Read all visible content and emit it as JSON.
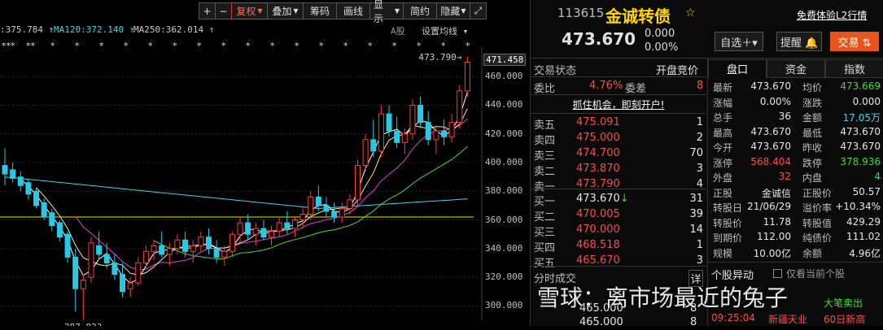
{
  "toolbar": {
    "plus": "+",
    "minus": "−",
    "fuquan": "复权",
    "diejia": "叠加",
    "chouma": "筹码",
    "huaxian": "画线",
    "xianshi": "显示",
    "jianyue": "简约",
    "yincang": "隐藏",
    "expand": "⤢"
  },
  "ma_labels": {
    "ma_a": ":375.784 ↑",
    "ma120": "MA120:372.140 ↑",
    "ma250": "MA250:362.014 ↑",
    "a_share": "A股",
    "settings": "设置均线"
  },
  "chart_data": {
    "type": "candlestick",
    "title": "",
    "ylim": [
      290,
      476
    ],
    "y_ticks": [
      300,
      320,
      340,
      360,
      380,
      400,
      420,
      440,
      460
    ],
    "y_tick_labels": [
      "300.000",
      "320.000",
      "340.000",
      "360.000",
      "380.000",
      "400.000",
      "420.000",
      "440.000",
      "460.000"
    ],
    "current_price_label": "471.458",
    "high_label": "473.790",
    "low_label": "287.823",
    "high_value": 473.79,
    "low_value": 287.823,
    "reference_price": 362,
    "markers": [
      "***",
      "**",
      "*",
      "*",
      "*",
      "*",
      "*",
      "*",
      "*",
      "*",
      "*",
      "*",
      "*",
      "*",
      "*",
      "*",
      "*",
      "*",
      "*",
      "*"
    ],
    "candles": [
      {
        "o": 398,
        "h": 410,
        "l": 384,
        "c": 392
      },
      {
        "o": 395,
        "h": 400,
        "l": 386,
        "c": 389
      },
      {
        "o": 390,
        "h": 394,
        "l": 380,
        "c": 384
      },
      {
        "o": 386,
        "h": 388,
        "l": 374,
        "c": 378
      },
      {
        "o": 380,
        "h": 382,
        "l": 368,
        "c": 370
      },
      {
        "o": 372,
        "h": 375,
        "l": 360,
        "c": 362
      },
      {
        "o": 365,
        "h": 368,
        "l": 352,
        "c": 356
      },
      {
        "o": 358,
        "h": 360,
        "l": 345,
        "c": 348
      },
      {
        "o": 350,
        "h": 352,
        "l": 330,
        "c": 334
      },
      {
        "o": 334,
        "h": 340,
        "l": 296,
        "c": 312
      },
      {
        "o": 312,
        "h": 322,
        "l": 290,
        "c": 318
      },
      {
        "o": 320,
        "h": 348,
        "l": 316,
        "c": 344
      },
      {
        "o": 342,
        "h": 352,
        "l": 332,
        "c": 336
      },
      {
        "o": 336,
        "h": 344,
        "l": 326,
        "c": 330
      },
      {
        "o": 330,
        "h": 336,
        "l": 318,
        "c": 322
      },
      {
        "o": 322,
        "h": 330,
        "l": 306,
        "c": 310
      },
      {
        "o": 312,
        "h": 320,
        "l": 306,
        "c": 316
      },
      {
        "o": 316,
        "h": 334,
        "l": 314,
        "c": 330
      },
      {
        "o": 330,
        "h": 342,
        "l": 326,
        "c": 338
      },
      {
        "o": 338,
        "h": 346,
        "l": 332,
        "c": 342
      },
      {
        "o": 342,
        "h": 352,
        "l": 334,
        "c": 336
      },
      {
        "o": 336,
        "h": 344,
        "l": 328,
        "c": 340
      },
      {
        "o": 340,
        "h": 350,
        "l": 336,
        "c": 346
      },
      {
        "o": 346,
        "h": 352,
        "l": 334,
        "c": 338
      },
      {
        "o": 338,
        "h": 346,
        "l": 330,
        "c": 342
      },
      {
        "o": 342,
        "h": 352,
        "l": 338,
        "c": 348
      },
      {
        "o": 348,
        "h": 354,
        "l": 336,
        "c": 340
      },
      {
        "o": 340,
        "h": 346,
        "l": 330,
        "c": 334
      },
      {
        "o": 334,
        "h": 342,
        "l": 328,
        "c": 338
      },
      {
        "o": 338,
        "h": 352,
        "l": 334,
        "c": 350
      },
      {
        "o": 350,
        "h": 362,
        "l": 344,
        "c": 358
      },
      {
        "o": 358,
        "h": 364,
        "l": 346,
        "c": 350
      },
      {
        "o": 350,
        "h": 358,
        "l": 342,
        "c": 354
      },
      {
        "o": 354,
        "h": 360,
        "l": 346,
        "c": 348
      },
      {
        "o": 348,
        "h": 356,
        "l": 342,
        "c": 352
      },
      {
        "o": 352,
        "h": 362,
        "l": 348,
        "c": 358
      },
      {
        "o": 358,
        "h": 366,
        "l": 350,
        "c": 354
      },
      {
        "o": 354,
        "h": 362,
        "l": 348,
        "c": 360
      },
      {
        "o": 360,
        "h": 368,
        "l": 354,
        "c": 364
      },
      {
        "o": 364,
        "h": 380,
        "l": 360,
        "c": 376
      },
      {
        "o": 376,
        "h": 384,
        "l": 366,
        "c": 370
      },
      {
        "o": 370,
        "h": 376,
        "l": 362,
        "c": 366
      },
      {
        "o": 366,
        "h": 372,
        "l": 358,
        "c": 362
      },
      {
        "o": 362,
        "h": 372,
        "l": 358,
        "c": 368
      },
      {
        "o": 368,
        "h": 378,
        "l": 364,
        "c": 374
      },
      {
        "o": 374,
        "h": 402,
        "l": 370,
        "c": 398
      },
      {
        "o": 398,
        "h": 420,
        "l": 394,
        "c": 416
      },
      {
        "o": 416,
        "h": 430,
        "l": 404,
        "c": 408
      },
      {
        "o": 408,
        "h": 440,
        "l": 404,
        "c": 434
      },
      {
        "o": 434,
        "h": 440,
        "l": 418,
        "c": 422
      },
      {
        "o": 422,
        "h": 432,
        "l": 410,
        "c": 414
      },
      {
        "o": 414,
        "h": 424,
        "l": 406,
        "c": 420
      },
      {
        "o": 420,
        "h": 444,
        "l": 416,
        "c": 440
      },
      {
        "o": 440,
        "h": 446,
        "l": 424,
        "c": 428
      },
      {
        "o": 428,
        "h": 436,
        "l": 412,
        "c": 416
      },
      {
        "o": 416,
        "h": 426,
        "l": 406,
        "c": 422
      },
      {
        "o": 422,
        "h": 430,
        "l": 412,
        "c": 418
      },
      {
        "o": 418,
        "h": 434,
        "l": 414,
        "c": 428
      },
      {
        "o": 428,
        "h": 454,
        "l": 424,
        "c": 450
      },
      {
        "o": 450,
        "h": 474,
        "l": 446,
        "c": 470
      }
    ]
  },
  "header": {
    "code": "113615",
    "name": "金诚转债",
    "upgrade_link": "免费体验L2行情",
    "price": "473.670",
    "change": "0.000",
    "change_pct": "0.00%",
    "btn_zixuan": "自选＋▾",
    "btn_tixing": "提醒 🔔",
    "btn_jiaoyi": "交易 ⇅"
  },
  "trade_status": {
    "label": "交易状态",
    "value": "开盘竞价"
  },
  "weibi": {
    "label": "委比",
    "value": "4.76%",
    "label2": "委差",
    "value2": "8"
  },
  "promo": "抓住机会，即刻开户!",
  "asks": [
    {
      "label": "卖五",
      "price": "475.091",
      "vol": "1"
    },
    {
      "label": "卖四",
      "price": "475.000",
      "vol": "2"
    },
    {
      "label": "卖三",
      "price": "474.700",
      "vol": "70"
    },
    {
      "label": "卖二",
      "price": "473.870",
      "vol": "3"
    },
    {
      "label": "卖一",
      "price": "473.790",
      "vol": "4"
    }
  ],
  "bids": [
    {
      "label": "买一",
      "price": "473.670↓",
      "vol": "31"
    },
    {
      "label": "买二",
      "price": "470.005",
      "vol": "39"
    },
    {
      "label": "买三",
      "price": "470.000",
      "vol": "14"
    },
    {
      "label": "买四",
      "price": "468.518",
      "vol": "1"
    },
    {
      "label": "买五",
      "price": "465.670",
      "vol": "3"
    }
  ],
  "trades_header": {
    "label": "分时成交",
    "detail": "详"
  },
  "trades": [
    {
      "price": "465.000",
      "vol": "8"
    },
    {
      "price": "465.000",
      "vol": "8"
    }
  ],
  "tabs": [
    "盘口",
    "资金",
    "指数"
  ],
  "details": [
    [
      "最新",
      "473.670",
      "均价",
      "473.669"
    ],
    [
      "涨幅",
      "0.00%",
      "涨跌",
      "0.000"
    ],
    [
      "总手",
      "36",
      "金额",
      "17.05万"
    ],
    [
      "最高",
      "473.670",
      "最低",
      "473.670"
    ],
    [
      "今开",
      "473.670",
      "昨收",
      "473.670"
    ],
    [
      "涨停",
      "568.404",
      "跌停",
      "378.936"
    ],
    [
      "外盘",
      "32",
      "内盘",
      "4"
    ],
    [
      "正股",
      "金诚信",
      "正股价",
      "50.57"
    ],
    [
      "转股日",
      "21/06/29",
      "溢价率",
      "+10.34%"
    ],
    [
      "转股价",
      "11.78",
      "转股值",
      "429.29"
    ],
    [
      "到期价",
      "112.00",
      "纯债价",
      "111.02"
    ],
    [
      "规模",
      "10.00亿",
      "余额",
      "4.96亿"
    ]
  ],
  "stock_moves": {
    "label": "个股异动",
    "checkbox": "仅看当前个股",
    "item1": "大笔卖出",
    "time2": "09:25:04",
    "name2": "新疆天业",
    "event2": "60日新高"
  },
  "watermark": "雪球：离市场最近的兔子",
  "colors": {
    "up": "#ff3b3b",
    "down": "#29c9e6",
    "accent": "#ffd700"
  }
}
